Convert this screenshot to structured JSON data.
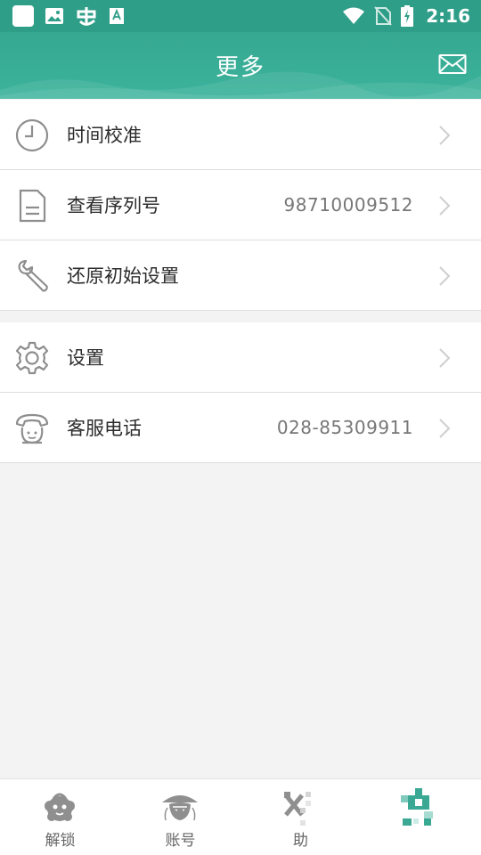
{
  "status_bar": {
    "time": "2:16",
    "left_icons": [
      "app-square-icon",
      "image-icon",
      "bug-icon",
      "font-download-icon"
    ],
    "right_icons": [
      "wifi-icon",
      "no-sim-icon",
      "battery-charging-icon"
    ]
  },
  "header": {
    "title": "更多",
    "mail_icon": "mail-icon",
    "color": "#36a891"
  },
  "menu": {
    "group1": [
      {
        "label": "时间校准",
        "value": "",
        "icon": "clock-icon"
      },
      {
        "label": "查看序列号",
        "value": "98710009512",
        "icon": "document-icon"
      },
      {
        "label": "还原初始设置",
        "value": "",
        "icon": "wrench-icon"
      }
    ],
    "group2": [
      {
        "label": "设置",
        "value": "",
        "icon": "gear-icon"
      },
      {
        "label": "客服电话",
        "value": "028-85309911",
        "icon": "phone-icon"
      }
    ]
  },
  "bottom_nav": {
    "items": [
      {
        "label": "解锁",
        "icon": "unlock-mascot-icon"
      },
      {
        "label": "账号",
        "icon": "account-mascot-icon"
      },
      {
        "label": "助",
        "icon": "helper-tools-icon"
      },
      {
        "label": "",
        "icon": "more-pixel-icon",
        "active": true
      }
    ],
    "active_color": "#3aa893",
    "inactive_color": "#8f8f8f"
  }
}
